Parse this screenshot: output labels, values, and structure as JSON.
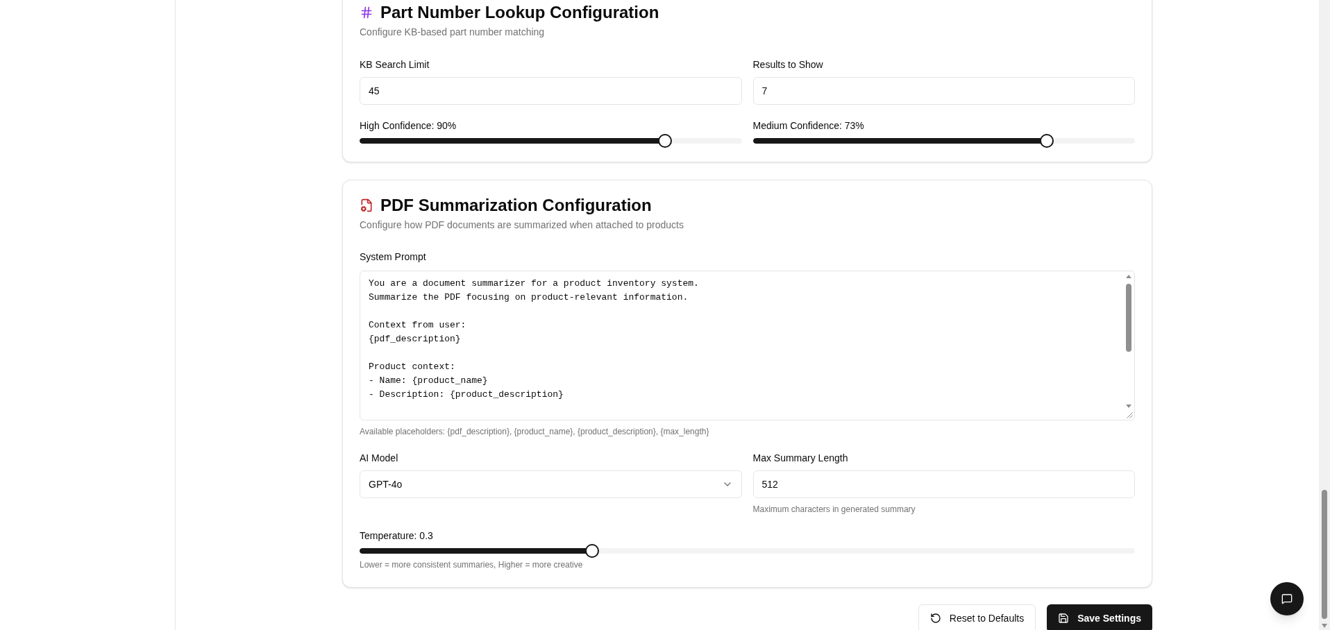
{
  "part_lookup": {
    "title": "Part Number Lookup Configuration",
    "subtitle": "Configure KB-based part number matching",
    "fields": [
      {
        "label": "KB Search Limit",
        "value": "45"
      },
      {
        "label": "Results to Show",
        "value": "7"
      }
    ],
    "sliders": [
      {
        "label": "High Confidence: 90%",
        "level": 0.8
      },
      {
        "label": "Medium Confidence: 73%",
        "level": 0.77
      }
    ]
  },
  "pdf_summary": {
    "title": "PDF Summarization Configuration",
    "subtitle": "Configure how PDF documents are summarized when attached to products",
    "system_prompt": {
      "label": "System Prompt",
      "value": "You are a document summarizer for a product inventory system.\nSummarize the PDF focusing on product-relevant information.\n\nContext from user:\n{pdf_description}\n\nProduct context:\n- Name: {product_name}\n- Description: {product_description}",
      "hint": "Available placeholders: {pdf_description}, {product_name}, {product_description}, {max_length}"
    },
    "model": {
      "label": "AI Model",
      "value": "GPT-4o"
    },
    "max_length": {
      "label": "Max Summary Length",
      "value": "512",
      "hint": "Maximum characters in generated summary"
    },
    "temperature": {
      "label": "Temperature: 0.3",
      "level": 0.3,
      "hint": "Lower = more consistent summaries, Higher = more creative"
    }
  },
  "actions": [
    {
      "label": "Reset to Defaults",
      "kind": "secondary"
    },
    {
      "label": "Save Settings",
      "kind": "primary"
    }
  ]
}
